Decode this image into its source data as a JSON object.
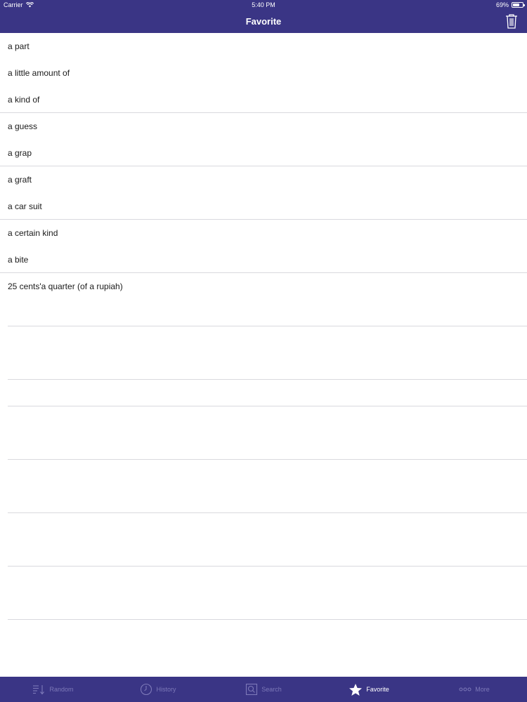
{
  "colors": {
    "brand": "#3a3585",
    "tab_inactive": "#7d79b8",
    "text": "#1a1a1a"
  },
  "status_bar": {
    "carrier": "Carrier",
    "time": "5:40 PM",
    "battery_text": "69%",
    "battery_level": 0.69
  },
  "nav": {
    "title": "Favorite",
    "trash_icon": "trash-icon"
  },
  "favorites": [
    "a part",
    "a little amount of",
    "a kind of",
    "a guess",
    "a grap",
    "a graft",
    "a car suit",
    "a certain kind",
    "a bite",
    "25 cents'a quarter (of a rupiah)"
  ],
  "tabs": [
    {
      "label": "Random",
      "icon": "shuffle-icon",
      "active": false
    },
    {
      "label": "History",
      "icon": "clock-icon",
      "active": false
    },
    {
      "label": "Search",
      "icon": "search-icon",
      "active": false
    },
    {
      "label": "Favorite",
      "icon": "star-icon",
      "active": true
    },
    {
      "label": "More",
      "icon": "more-icon",
      "active": false
    }
  ]
}
